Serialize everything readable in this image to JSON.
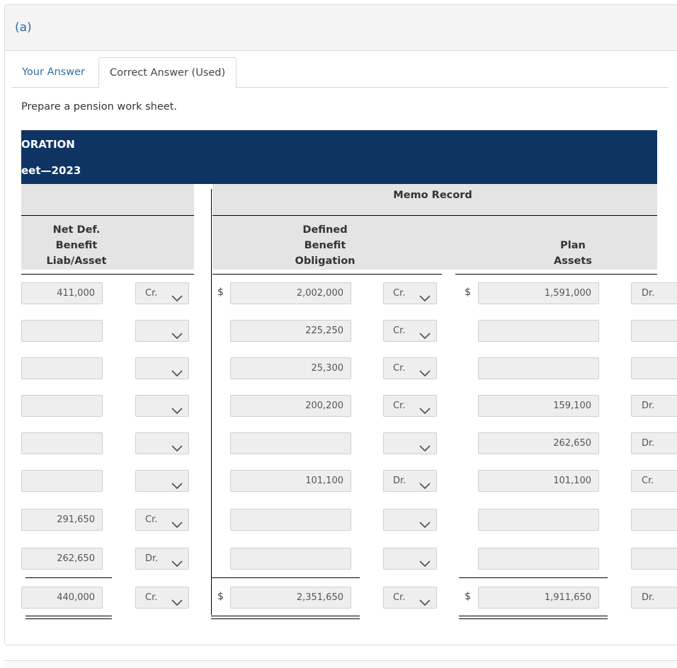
{
  "part_label": "(a)",
  "tabs": [
    {
      "label": "Your Answer",
      "active": false
    },
    {
      "label": "Correct Answer (Used)",
      "active": true
    }
  ],
  "prompt": "Prepare a pension work sheet.",
  "banner": {
    "line1": "ORATION",
    "line2": "eet—2023"
  },
  "memo_header": "Memo Record",
  "columns": {
    "net_def": [
      "Net Def.",
      "Benefit",
      "Liab/Asset"
    ],
    "dbo": [
      "Defined",
      "Benefit",
      "Obligation"
    ],
    "plan_assets": [
      "Plan",
      "Assets"
    ]
  },
  "currency_symbol": "$",
  "rows": [
    {
      "net": "411,000",
      "net_dc": "Cr.",
      "dbo": "2,002,000",
      "dbo_dc": "Cr.",
      "pa": "1,591,000",
      "pa_dc": "Dr."
    },
    {
      "net": "",
      "net_dc": "",
      "dbo": "225,250",
      "dbo_dc": "Cr.",
      "pa": "",
      "pa_dc": ""
    },
    {
      "net": "",
      "net_dc": "",
      "dbo": "25,300",
      "dbo_dc": "Cr.",
      "pa": "",
      "pa_dc": ""
    },
    {
      "net": "",
      "net_dc": "",
      "dbo": "200,200",
      "dbo_dc": "Cr.",
      "pa": "159,100",
      "pa_dc": "Dr."
    },
    {
      "net": "",
      "net_dc": "",
      "dbo": "",
      "dbo_dc": "",
      "pa": "262,650",
      "pa_dc": "Dr."
    },
    {
      "net": "",
      "net_dc": "",
      "dbo": "101,100",
      "dbo_dc": "Dr.",
      "pa": "101,100",
      "pa_dc": "Cr."
    },
    {
      "net": "291,650",
      "net_dc": "Cr.",
      "dbo": "",
      "dbo_dc": "",
      "pa": "",
      "pa_dc": ""
    },
    {
      "net": "262,650",
      "net_dc": "Dr.",
      "dbo": "",
      "dbo_dc": "",
      "pa": "",
      "pa_dc": ""
    },
    {
      "net": "440,000",
      "net_dc": "Cr.",
      "dbo": "2,351,650",
      "dbo_dc": "Cr.",
      "pa": "1,911,650",
      "pa_dc": "Dr."
    }
  ],
  "colors": {
    "banner_bg": "#0f3463",
    "link_blue": "#2e6da4",
    "header_bg": "#e4e4e4",
    "input_bg": "#eeeeee"
  }
}
